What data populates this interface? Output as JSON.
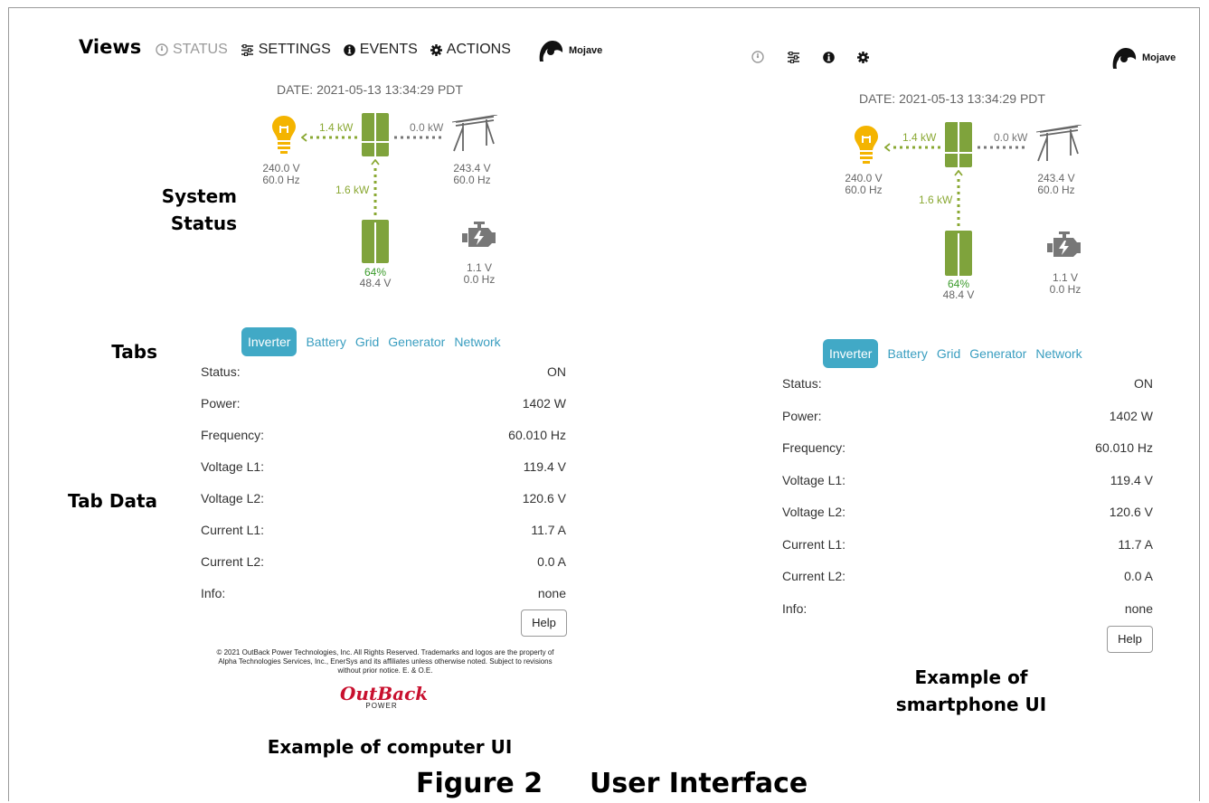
{
  "callouts": {
    "views": "Views",
    "system_status_1": "System",
    "system_status_2": "Status",
    "tabs": "Tabs",
    "tab_data": "Tab Data"
  },
  "desktop": {
    "nav": [
      {
        "label": "STATUS",
        "icon": "gauge-icon",
        "state": "muted"
      },
      {
        "label": "SETTINGS",
        "icon": "sliders-icon"
      },
      {
        "label": "EVENTS",
        "icon": "info-circle-icon"
      },
      {
        "label": "ACTIONS",
        "icon": "gear-icon"
      }
    ],
    "user": "Mojave",
    "date": "DATE: 2021-05-13 13:34:29 PDT",
    "diagram": {
      "load_power": "1.4 kW",
      "grid_power": "0.0 kW",
      "battery_power": "1.6 kW",
      "load_voltage": "240.0 V",
      "load_freq": "60.0 Hz",
      "grid_voltage": "243.4 V",
      "grid_freq": "60.0 Hz",
      "battery_pct": "64%",
      "battery_voltage": "48.4 V",
      "gen_voltage": "1.1 V",
      "gen_freq": "0.0 Hz",
      "battery_fill": 0.64
    },
    "tabs": [
      "Inverter",
      "Battery",
      "Grid",
      "Generator",
      "Network"
    ],
    "rows": [
      {
        "label": "Status:",
        "value": "ON"
      },
      {
        "label": "Power:",
        "value": "1402 W"
      },
      {
        "label": "Frequency:",
        "value": "60.010 Hz"
      },
      {
        "label": "Voltage L1:",
        "value": "119.4 V"
      },
      {
        "label": "Voltage L2:",
        "value": "120.6 V"
      },
      {
        "label": "Current L1:",
        "value": "11.7 A"
      },
      {
        "label": "Current L2:",
        "value": "0.0 A"
      },
      {
        "label": "Info:",
        "value": "none"
      }
    ],
    "help": "Help",
    "footer_1": "© 2021 OutBack Power Technologies, Inc. All Rights Reserved. Trademarks and logos are the property of",
    "footer_2": "Alpha Technologies Services, Inc., EnerSys and its affiliates unless otherwise noted. Subject to revisions",
    "footer_3": "without prior notice. E. & O.E.",
    "brand_logo": "OutBack",
    "brand_sub": "POWER"
  },
  "mobile": {
    "user": "Mojave",
    "date": "DATE: 2021-05-13 13:34:29 PDT",
    "diagram": {
      "load_power": "1.4 kW",
      "grid_power": "0.0 kW",
      "battery_power": "1.6 kW",
      "load_voltage": "240.0 V",
      "load_freq": "60.0 Hz",
      "grid_voltage": "243.4 V",
      "grid_freq": "60.0 Hz",
      "battery_pct": "64%",
      "battery_voltage": "48.4 V",
      "gen_voltage": "1.1 V",
      "gen_freq": "0.0 Hz",
      "battery_fill": 0.64
    },
    "tabs": [
      "Inverter",
      "Battery",
      "Grid",
      "Generator",
      "Network"
    ],
    "rows": [
      {
        "label": "Status:",
        "value": "ON"
      },
      {
        "label": "Power:",
        "value": "1402 W"
      },
      {
        "label": "Frequency:",
        "value": "60.010 Hz"
      },
      {
        "label": "Voltage L1:",
        "value": "119.4 V"
      },
      {
        "label": "Voltage L2:",
        "value": "120.6 V"
      },
      {
        "label": "Current L1:",
        "value": "11.7 A"
      },
      {
        "label": "Current L2:",
        "value": "0.0 A"
      },
      {
        "label": "Info:",
        "value": "none"
      }
    ],
    "help": "Help"
  },
  "captions": {
    "computer": "Example of computer UI",
    "phone_1": "Example of",
    "phone_2": "smartphone UI",
    "figure_num": "Figure 2",
    "figure_title": "User Interface"
  },
  "colors": {
    "green": "#8aa833",
    "tab_active": "#41a9c6",
    "tab_text": "#3a9ec0",
    "bulb": "#f4b400",
    "brand_red": "#c8102e"
  }
}
